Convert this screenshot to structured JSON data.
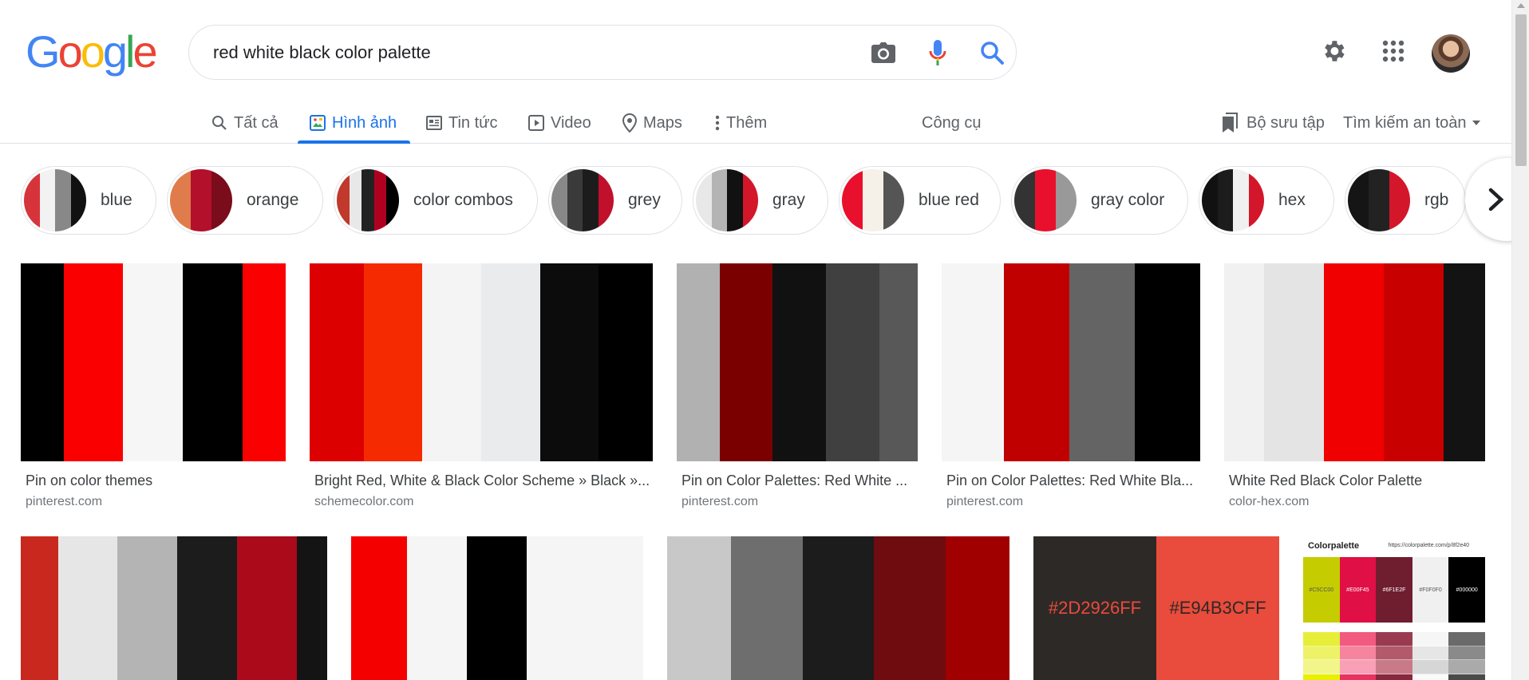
{
  "search": {
    "query": "red white black color palette"
  },
  "tabs": [
    {
      "label": "Tất cả",
      "icon": "search-icon"
    },
    {
      "label": "Hình ảnh",
      "icon": "image-icon",
      "active": true
    },
    {
      "label": "Tin tức",
      "icon": "news-icon"
    },
    {
      "label": "Video",
      "icon": "video-icon"
    },
    {
      "label": "Maps",
      "icon": "map-pin-icon"
    },
    {
      "label": "Thêm",
      "icon": "more-vert-icon"
    }
  ],
  "tools_label": "Công cụ",
  "collections_label": "Bộ sưu tập",
  "safe_search_label": "Tìm kiếm an toàn",
  "chips": [
    {
      "label": "blue",
      "colors": [
        "#d6343a",
        "#f2f2f2",
        "#888888",
        "#111111"
      ]
    },
    {
      "label": "orange",
      "colors": [
        "#e07c4c",
        "#b3102c",
        "#7a0c1c"
      ]
    },
    {
      "label": "color combos",
      "colors": [
        "#c0392b",
        "#e8e8e8",
        "#222222",
        "#b00020",
        "#000000"
      ]
    },
    {
      "label": "grey",
      "colors": [
        "#888888",
        "#3a3a3a",
        "#1c1c1c",
        "#c0102c"
      ]
    },
    {
      "label": "gray",
      "colors": [
        "#e8e8e8",
        "#b4b4b4",
        "#111111",
        "#d3162a"
      ]
    },
    {
      "label": "blue red",
      "colors": [
        "#e8102c",
        "#f5f0e8",
        "#555555"
      ]
    },
    {
      "label": "gray color",
      "colors": [
        "#333333",
        "#e8102c",
        "#999999"
      ]
    },
    {
      "label": "hex",
      "colors": [
        "#111111",
        "#1c1c1c",
        "#f0f0f0",
        "#d3162a"
      ]
    },
    {
      "label": "rgb",
      "colors": [
        "#151515",
        "#222222",
        "#d3162a"
      ]
    }
  ],
  "results": [
    {
      "title": "Pin on color themes",
      "source": "pinterest.com",
      "colors": [
        "#000000",
        "#fa0000",
        "#f6f6f6",
        "#000000",
        "#fa0000"
      ],
      "weights": [
        54,
        74,
        75,
        75,
        54
      ]
    },
    {
      "title": "Bright Red, White & Black Color Scheme » Black »...",
      "source": "schemecolor.com",
      "colors": [
        "#dc0000",
        "#f62a00",
        "#f4f4f4",
        "#eaebed",
        "#0c0c0c",
        "#000000"
      ],
      "weights": [
        68,
        74,
        74,
        74,
        74,
        68
      ]
    },
    {
      "title": "Pin on Color Palettes: Red White ...",
      "source": "pinterest.com",
      "colors": [
        "#b1b1b1",
        "#7a0000",
        "#111111",
        "#404040",
        "#585858"
      ],
      "weights": [
        54,
        66,
        67,
        67,
        48
      ]
    },
    {
      "title": "Pin on Color Palettes: Red White Bla...",
      "source": "pinterest.com",
      "colors": [
        "#f5f5f5",
        "#c00000",
        "#646464",
        "#000000"
      ],
      "weights": [
        78,
        82,
        82,
        82
      ]
    },
    {
      "title": "White Red Black Color Palette",
      "source": "color-hex.com",
      "colors": [
        "#f1f1f1",
        "#e4e4e4",
        "#f00000",
        "#c80000",
        "#131313"
      ],
      "weights": [
        50,
        75,
        75,
        75,
        52
      ]
    },
    {
      "colors": [
        "#c8281e",
        "#e6e6e6",
        "#b4b4b4",
        "#1c1c1c",
        "#aa0a1a",
        "#141414"
      ],
      "weights": [
        47,
        74,
        75,
        75,
        75,
        38
      ]
    },
    {
      "colors": [
        "#f50000",
        "#f5f5f5",
        "#000000",
        "#f5f5f5"
      ],
      "weights": [
        70,
        75,
        75,
        146
      ]
    },
    {
      "colors": [
        "#c8c8c8",
        "#6e6e6e",
        "#1c1c1c",
        "#6e0c10",
        "#a00000"
      ],
      "weights": [
        80,
        90,
        90,
        90,
        80
      ]
    },
    {
      "hex_labels": [
        "#2D2926FF",
        "#E94B3CFF"
      ],
      "colors": [
        "#2d2926",
        "#e94b3c"
      ],
      "label_colors": [
        "#e94b3c",
        "#2d2926"
      ]
    },
    {
      "brand": "Colorpalette",
      "url": "https://colorpalette.com/p/8f2e40",
      "swatch_labels": [
        "#C5CC00",
        "#E00F45",
        "#6F1E2F",
        "#F0F0F0",
        "#000000"
      ],
      "colors": [
        "#c5cc00",
        "#e00f45",
        "#6f1e2f",
        "#f0f0f0",
        "#000000"
      ]
    }
  ]
}
